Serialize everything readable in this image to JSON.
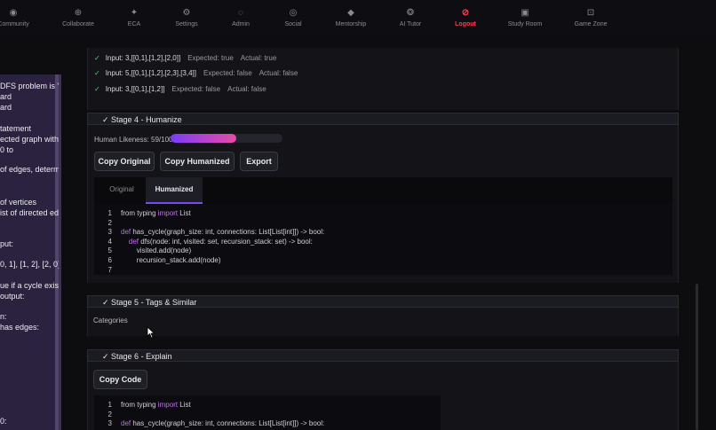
{
  "nav": [
    {
      "label": "Community",
      "icon": "community-icon",
      "glyph": "◉"
    },
    {
      "label": "Collaborate",
      "icon": "collaborate-icon",
      "glyph": "⊕"
    },
    {
      "label": "ECA",
      "icon": "eca-icon",
      "glyph": "✦"
    },
    {
      "label": "Settings",
      "icon": "settings-icon",
      "glyph": "⚙"
    },
    {
      "label": "Admin",
      "icon": "admin-icon",
      "glyph": "◌"
    },
    {
      "label": "Social",
      "icon": "social-icon",
      "glyph": "◎"
    },
    {
      "label": "Mentorship",
      "icon": "mentorship-icon",
      "glyph": "◆"
    },
    {
      "label": "AI Tutor",
      "icon": "ai-tutor-icon",
      "glyph": "❂"
    },
    {
      "label": "Logout",
      "icon": "logout-icon",
      "glyph": "⊘"
    },
    {
      "label": "Study Room",
      "icon": "study-room-icon",
      "glyph": "▣"
    },
    {
      "label": "Game Zone",
      "icon": "game-zone-icon",
      "glyph": "⊡"
    }
  ],
  "left_panel": [
    "DFS problem is \"D",
    "ard",
    "ard",
    "tatement",
    "ected graph with",
    "0 to",
    "of edges, determ",
    "of vertices",
    "ist of directed edg",
    "put:",
    "0, 1], [1, 2], [2, 0]",
    "ue if a cycle exist",
    "output:",
    "n:",
    "has edges:",
    "0:"
  ],
  "tests": [
    {
      "input": "Input: 3,[[0,1],[1,2],[2,0]]",
      "expected": "Expected: true",
      "actual": "Actual: true"
    },
    {
      "input": "Input: 5,[[0,1],[1,2],[2,3],[3,4]]",
      "expected": "Expected: false",
      "actual": "Actual: false"
    },
    {
      "input": "Input: 3,[[0,1],[1,2]]",
      "expected": "Expected: false",
      "actual": "Actual: false"
    }
  ],
  "stage4": {
    "title": "✓ Stage 4 - Humanize",
    "likeness_label": "Human Likeness: 59/100",
    "likeness_value": 59,
    "copy_original": "Copy Original",
    "copy_humanized": "Copy Humanized",
    "export": "Export",
    "tab_original": "Original",
    "tab_humanized": "Humanized",
    "code": [
      {
        "n": "1",
        "pre": "from typing ",
        "kw": "import",
        "post": " List"
      },
      {
        "n": "2",
        "pre": "",
        "kw": "",
        "post": ""
      },
      {
        "n": "3",
        "pre": "",
        "kw": "def",
        "post": " has_cycle(graph_size: int, connections: List[List[int]]) -> bool:"
      },
      {
        "n": "4",
        "pre": "    ",
        "kw": "def",
        "post": " dfs(node: int, visited: set, recursion_stack: set) -> bool:"
      },
      {
        "n": "5",
        "pre": "        visited.add(node)",
        "kw": "",
        "post": ""
      },
      {
        "n": "6",
        "pre": "        recursion_stack.add(node)",
        "kw": "",
        "post": ""
      },
      {
        "n": "7",
        "pre": "",
        "kw": "",
        "post": ""
      }
    ]
  },
  "stage5": {
    "title": "✓ Stage 5 - Tags & Similar",
    "categories": "Categories"
  },
  "stage6": {
    "title": "✓ Stage 6 - Explain",
    "copy_code": "Copy Code",
    "code": [
      {
        "n": "1",
        "pre": "from typing ",
        "kw": "import",
        "post": " List"
      },
      {
        "n": "2",
        "pre": "",
        "kw": "",
        "post": ""
      },
      {
        "n": "3",
        "pre": "",
        "kw": "def",
        "post": " has_cycle(graph_size: int, connections: List[List[int]]) -> bool:"
      }
    ]
  }
}
